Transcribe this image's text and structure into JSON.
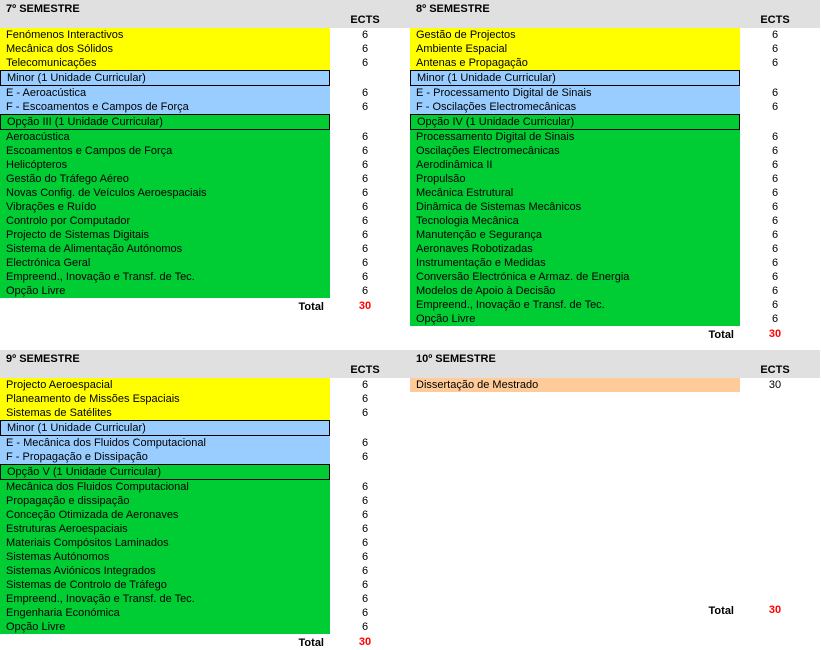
{
  "ects_header": "ECTS",
  "total_label": "Total",
  "sem7": {
    "title": "7º SEMESTRE",
    "yellow": [
      {
        "name": "Fenómenos Interactivos",
        "ects": 6
      },
      {
        "name": "Mecânica dos Sólidos",
        "ects": 6
      },
      {
        "name": "Telecomunicações",
        "ects": 6
      }
    ],
    "minor_label": "Minor (1 Unidade Curricular)",
    "minor": [
      {
        "name": "E - Aeroacústica",
        "ects": 6
      },
      {
        "name": "F - Escoamentos e Campos de Força",
        "ects": 6
      }
    ],
    "opcao_label": "Opção III (1 Unidade Curricular)",
    "opcao": [
      {
        "name": "Aeroacústica",
        "ects": 6
      },
      {
        "name": "Escoamentos e Campos de Força",
        "ects": 6
      },
      {
        "name": "Helicópteros",
        "ects": 6
      },
      {
        "name": "Gestão do Tráfego Aéreo",
        "ects": 6
      },
      {
        "name": "Novas Config. de Veículos Aeroespaciais",
        "ects": 6
      },
      {
        "name": "Vibrações e Ruído",
        "ects": 6
      },
      {
        "name": "Controlo por Computador",
        "ects": 6
      },
      {
        "name": "Projecto de Sistemas Digitais",
        "ects": 6
      },
      {
        "name": "Sistema de Alimentação Autónomos",
        "ects": 6
      },
      {
        "name": "Electrónica Geral",
        "ects": 6
      },
      {
        "name": "Empreend., Inovação e Transf. de  Tec.",
        "ects": 6
      },
      {
        "name": "Opção Livre",
        "ects": 6
      }
    ],
    "total": 30
  },
  "sem8": {
    "title": "8º SEMESTRE",
    "yellow": [
      {
        "name": "Gestão de Projectos",
        "ects": 6
      },
      {
        "name": "Ambiente Espacial",
        "ects": 6
      },
      {
        "name": "Antenas e Propagação",
        "ects": 6
      }
    ],
    "minor_label": "Minor (1 Unidade Curricular)",
    "minor": [
      {
        "name": "E - Processamento Digital de Sinais",
        "ects": 6
      },
      {
        "name": "F - Oscilações Electromecânicas",
        "ects": 6
      }
    ],
    "opcao_label": "Opção IV (1 Unidade Curricular)",
    "opcao": [
      {
        "name": "Processamento Digital de Sinais",
        "ects": 6
      },
      {
        "name": "Oscilações Electromecânicas",
        "ects": 6
      },
      {
        "name": "Aerodinâmica II",
        "ects": 6
      },
      {
        "name": "Propulsão",
        "ects": 6
      },
      {
        "name": "Mecânica Estrutural",
        "ects": 6
      },
      {
        "name": "Dinâmica de Sistemas Mecânicos",
        "ects": 6
      },
      {
        "name": "Tecnologia Mecânica",
        "ects": 6
      },
      {
        "name": "Manutenção e Segurança",
        "ects": 6
      },
      {
        "name": "Aeronaves Robotizadas",
        "ects": 6
      },
      {
        "name": "Instrumentação e Medidas",
        "ects": 6
      },
      {
        "name": "Conversão Electrónica e Armaz. de Energia",
        "ects": 6
      },
      {
        "name": "Modelos de Apoio à Decisão",
        "ects": 6
      },
      {
        "name": "Empreend., Inovação e Transf. de  Tec.",
        "ects": 6
      },
      {
        "name": "Opção Livre",
        "ects": 6
      }
    ],
    "total": 30
  },
  "sem9": {
    "title": "9º SEMESTRE",
    "yellow": [
      {
        "name": "Projecto Aeroespacial",
        "ects": 6
      },
      {
        "name": "Planeamento de Missões Espaciais",
        "ects": 6
      },
      {
        "name": "Sistemas de Satélites",
        "ects": 6
      }
    ],
    "minor_label": "Minor (1 Unidade Curricular)",
    "minor": [
      {
        "name": "E - Mecânica dos Fluidos Computacional",
        "ects": 6
      },
      {
        "name": "F - Propagação e Dissipação",
        "ects": 6
      }
    ],
    "opcao_label": "Opção V (1 Unidade Curricular)",
    "opcao": [
      {
        "name": "Mecânica dos Fluidos Computacional",
        "ects": 6
      },
      {
        "name": "Propagação e dissipação",
        "ects": 6
      },
      {
        "name": "Conceção Otimizada de Aeronaves",
        "ects": 6
      },
      {
        "name": "Estruturas Aeroespaciais",
        "ects": 6
      },
      {
        "name": "Materiais Compósitos Laminados",
        "ects": 6
      },
      {
        "name": "Sistemas Autónomos",
        "ects": 6
      },
      {
        "name": "Sistemas Aviónicos Integrados",
        "ects": 6
      },
      {
        "name": "Sistemas de Controlo de Tráfego",
        "ects": 6
      },
      {
        "name": "Empreend., Inovação e Transf. de  Tec.",
        "ects": 6
      },
      {
        "name": "Engenharia Económica",
        "ects": 6
      },
      {
        "name": "Opção Livre",
        "ects": 6
      }
    ],
    "total": 30
  },
  "sem10": {
    "title": "10º SEMESTRE",
    "orange": [
      {
        "name": "Dissertação de Mestrado",
        "ects": 30
      }
    ],
    "total": 30
  }
}
